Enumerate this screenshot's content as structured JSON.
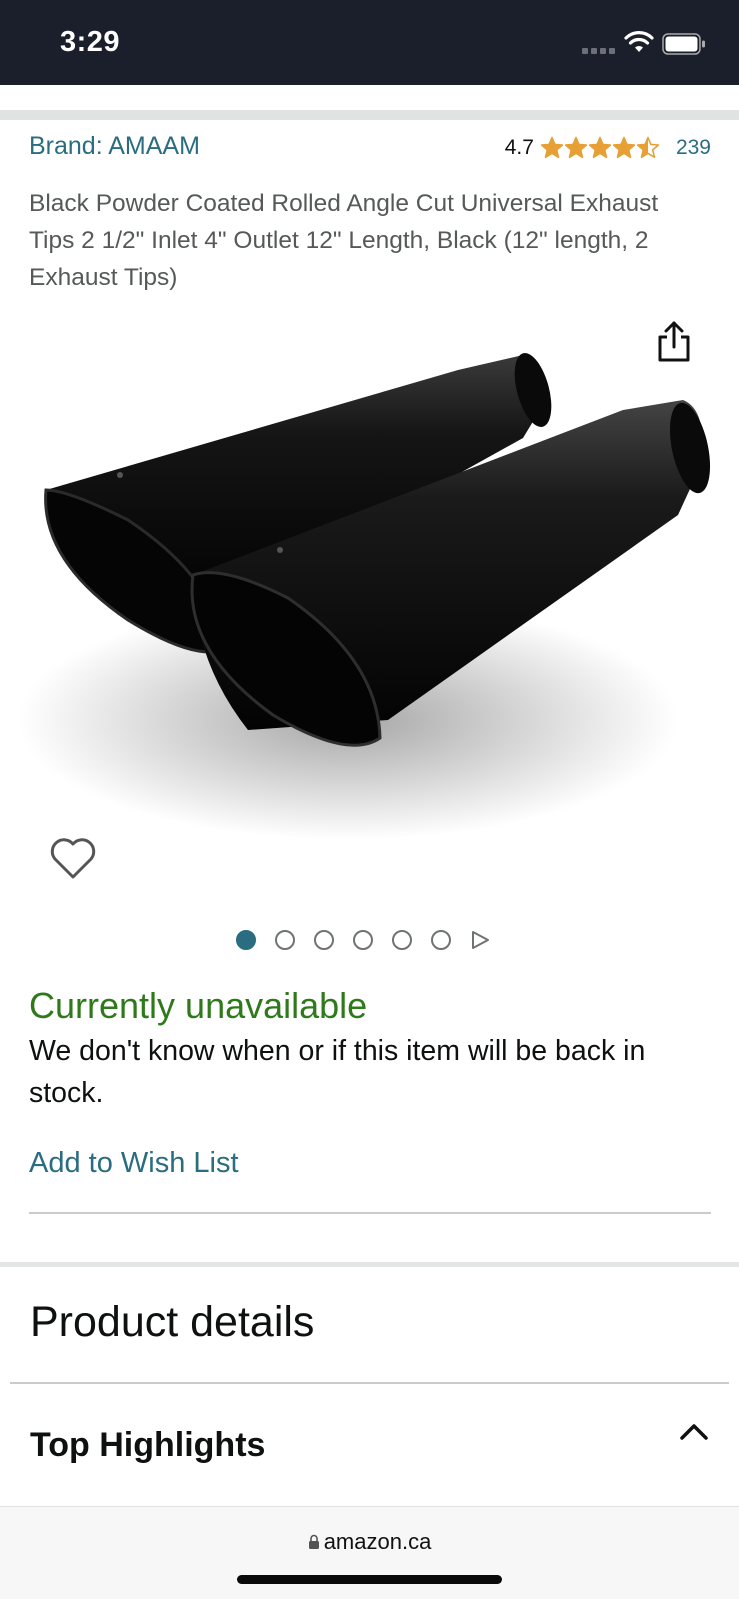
{
  "status_bar": {
    "time": "3:29"
  },
  "product": {
    "brand": "Brand: AMAAM",
    "rating": "4.7",
    "stars": 4.5,
    "review_count": "239",
    "title": "Black Powder Coated Rolled Angle Cut Universal Exhaust Tips 2 1/2\" Inlet 4\" Outlet 12\" Length, Black (12\" length, 2 Exhaust Tips)",
    "image_icon": "exhaust-tips-image",
    "image_count": 6,
    "active_image": 1
  },
  "availability": {
    "status": "Currently unavailable",
    "message": "We don't know when or if this item will be back in stock.",
    "wishlist_label": "Add to Wish List"
  },
  "sections": {
    "details_heading": "Product details",
    "highlights_label": "Top Highlights"
  },
  "browser": {
    "url": "amazon.ca"
  },
  "colors": {
    "link": "#2b6d80",
    "available_status": "#2e7a1a",
    "star": "#e7a035",
    "status_bar_bg": "#1a1f2b"
  }
}
